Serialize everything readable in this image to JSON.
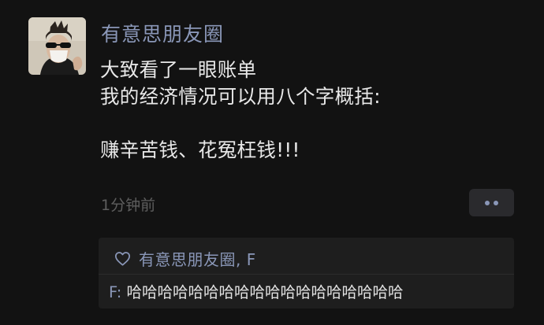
{
  "post": {
    "author_name": "有意思朋友圈",
    "lines": [
      "大致看了一眼账单",
      "我的经济情况可以用八个字概括:",
      "",
      "赚辛苦钱、花冤枉钱!!!"
    ],
    "timestamp": "1分钟前"
  },
  "interactions": {
    "likes_icon": "heart-icon",
    "likes": "有意思朋友圈, F",
    "comments": [
      {
        "author": "F",
        "separator": ": ",
        "text": "哈哈哈哈哈哈哈哈哈哈哈哈哈哈哈哈哈哈"
      }
    ]
  },
  "colors": {
    "background": "#121212",
    "name_blue": "#8a97b8",
    "text": "#e8e8e8",
    "muted": "#5e5e5e",
    "panel": "#1e1e1e"
  }
}
